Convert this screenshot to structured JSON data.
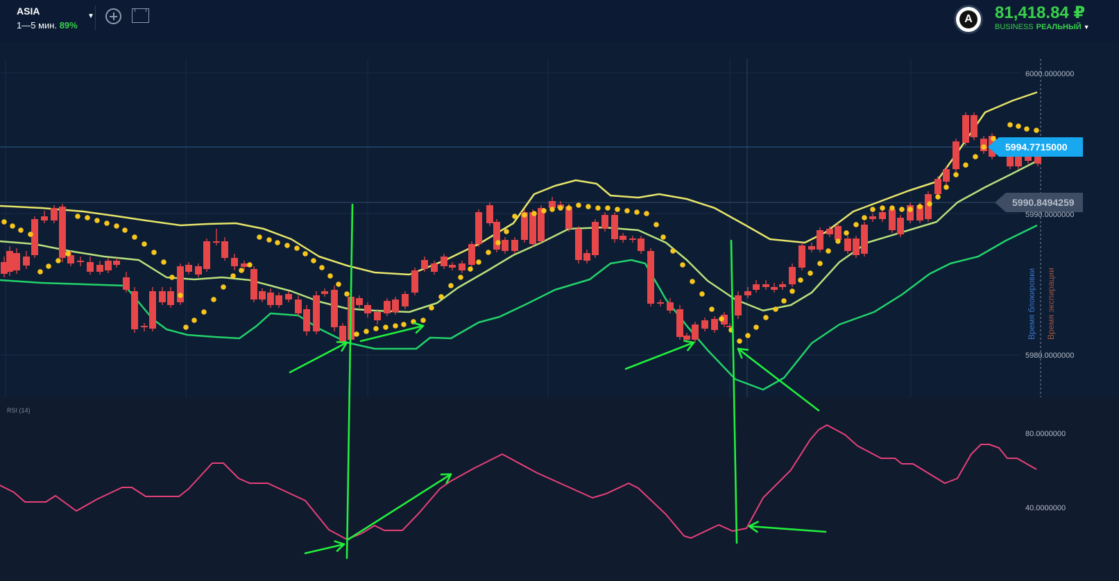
{
  "header": {
    "asset": "ASIA",
    "timeframe": "1—5 мин.",
    "payout": "89%",
    "avatar_letter": "A",
    "balance": "81,418.84 ₽",
    "account_type": "BUSINESS",
    "account_mode": "РЕАЛЬНЫЙ"
  },
  "chart_data": [
    {
      "type": "candlestick",
      "price_axis": {
        "ticks": [
          "6000.0000000",
          "5990.0000000",
          "5980.0000000"
        ],
        "current_price": "5994.7715000",
        "reference_price": "5990.8494259"
      },
      "indicators": [
        "Bollinger Bands",
        "Parabolic SAR"
      ],
      "vertical_labels": [
        "Время блокировки",
        "Время экспирации"
      ],
      "colors": {
        "bullish": "#1fd16a",
        "bearish": "#e8474a",
        "upper_band": "#e8e66a",
        "middle_band": "#b9e27c",
        "lower_band": "#22d36b",
        "sar": "#f7c61c",
        "annotation": "#22f03d"
      }
    },
    {
      "type": "line",
      "title": "RSI (14)",
      "ticks": [
        "80.0000000",
        "40.0000000"
      ],
      "color": "#e8407a"
    }
  ]
}
